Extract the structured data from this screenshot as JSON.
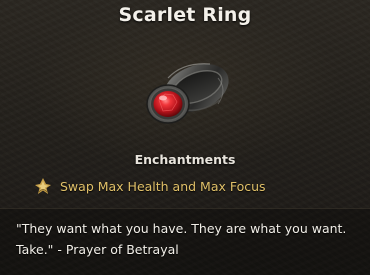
{
  "item": {
    "name": "Scarlet Ring",
    "image": "scarlet-ring-with-red-gem"
  },
  "enchantments": {
    "heading": "Enchantments",
    "items": [
      {
        "icon": "enchantment-sigil-icon",
        "text": "Swap Max Health and Max Focus",
        "color": "#e0c068"
      }
    ]
  },
  "lore": {
    "quote": "\"They want what you have. They are what you want. Take.\" - Prayer of Betrayal"
  },
  "colors": {
    "title": "#f4f1ea",
    "enchantment_text": "#e0c068",
    "gem": "#c0181c",
    "background": "#25221d"
  }
}
